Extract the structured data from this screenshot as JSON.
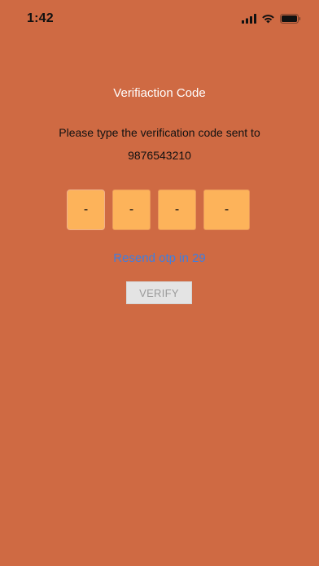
{
  "status_bar": {
    "time": "1:42",
    "icons": [
      "cellular-signal-icon",
      "wifi-icon",
      "battery-icon"
    ]
  },
  "screen": {
    "background_color": "#cf6a43",
    "title": "Verifiaction Code",
    "instruction": "Please type the verification code sent to",
    "phone_number": "9876543210"
  },
  "otp": {
    "digits": [
      "-",
      "-",
      "-",
      "-"
    ],
    "box_color": "#fdb35a"
  },
  "resend": {
    "label": "Resend otp in 29",
    "color": "#3e7ee0"
  },
  "verify_button": {
    "label": "VERIFY"
  }
}
